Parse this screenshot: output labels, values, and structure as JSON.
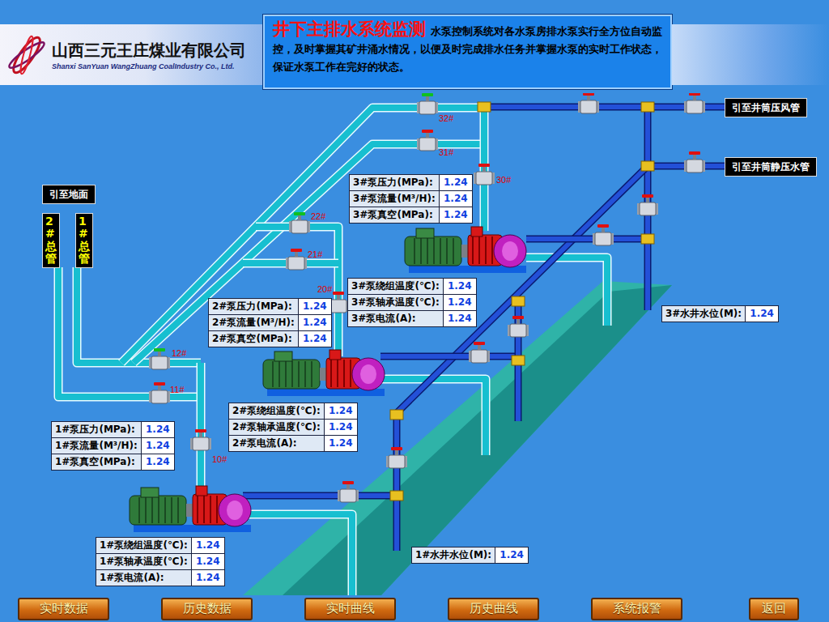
{
  "company": {
    "name": "山西三元王庄煤业有限公司",
    "name_en": "Shanxi SanYuan WangZhuang CoalIndustry Co., Ltd."
  },
  "header": {
    "title": "井下主排水系统监测",
    "description": "水泵控制系统对各水泵房排水泵实行全方位自动监控，及时掌握其矿井涌水情况，以便及时完成排水任务并掌握水泵的实时工作状态，保证水泵工作在完好的状态。"
  },
  "pipe_labels": [
    "引至井筒压风管",
    "引至井筒静压水管",
    "引至地面"
  ],
  "manifolds": [
    "2#总管",
    "1#总管"
  ],
  "valves": [
    {
      "label": "32#",
      "open": true
    },
    {
      "label": "31#",
      "open": false
    },
    {
      "label": "30#",
      "open": false
    },
    {
      "label": "22#",
      "open": true
    },
    {
      "label": "21#",
      "open": false
    },
    {
      "label": "20#",
      "open": false
    },
    {
      "label": "12#",
      "open": true
    },
    {
      "label": "11#",
      "open": false
    },
    {
      "label": "10#",
      "open": false
    },
    {
      "label": "",
      "open": false
    },
    {
      "label": "",
      "open": false
    },
    {
      "label": "",
      "open": false
    },
    {
      "label": "",
      "open": false
    },
    {
      "label": "",
      "open": false
    },
    {
      "label": "",
      "open": false
    },
    {
      "label": "",
      "open": false
    },
    {
      "label": "",
      "open": false
    },
    {
      "label": "",
      "open": false
    }
  ],
  "pumps": [
    {
      "name": "1#泵",
      "hydraulics": [
        {
          "label": "1#泵压力(MPa):",
          "value": "1.24"
        },
        {
          "label": "1#泵流量(M³/H):",
          "value": "1.24"
        },
        {
          "label": "1#泵真空(MPa):",
          "value": "1.24"
        }
      ],
      "electrics": [
        {
          "label": "1#泵绕组温度(℃):",
          "value": "1.24"
        },
        {
          "label": "1#泵轴承温度(℃):",
          "value": "1.24"
        },
        {
          "label": "1#泵电流(A):",
          "value": "1.24"
        }
      ]
    },
    {
      "name": "2#泵",
      "hydraulics": [
        {
          "label": "2#泵压力(MPa):",
          "value": "1.24"
        },
        {
          "label": "2#泵流量(M³/H):",
          "value": "1.24"
        },
        {
          "label": "2#泵真空(MPa):",
          "value": "1.24"
        }
      ],
      "electrics": [
        {
          "label": "2#泵绕组温度(℃):",
          "value": "1.24"
        },
        {
          "label": "2#泵轴承温度(℃):",
          "value": "1.24"
        },
        {
          "label": "2#泵电流(A):",
          "value": "1.24"
        }
      ]
    },
    {
      "name": "3#泵",
      "hydraulics": [
        {
          "label": "3#泵压力(MPa):",
          "value": "1.24"
        },
        {
          "label": "3#泵流量(M³/H):",
          "value": "1.24"
        },
        {
          "label": "3#泵真空(MPa):",
          "value": "1.24"
        }
      ],
      "electrics": [
        {
          "label": "3#泵绕组温度(℃):",
          "value": "1.24"
        },
        {
          "label": "3#泵轴承温度(℃):",
          "value": "1.24"
        },
        {
          "label": "3#泵电流(A):",
          "value": "1.24"
        }
      ]
    }
  ],
  "wells": [
    {
      "label": "1#水井水位(M):",
      "value": "1.24"
    },
    {
      "label": "3#水井水位(M):",
      "value": "1.24"
    }
  ],
  "buttons": [
    "实时数据",
    "历史数据",
    "实时曲线",
    "历史曲线",
    "系统报警",
    "返回"
  ]
}
